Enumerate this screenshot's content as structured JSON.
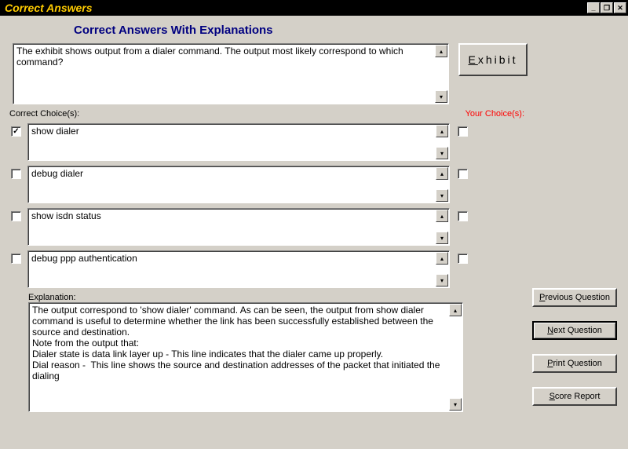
{
  "window": {
    "title": "Correct Answers"
  },
  "heading": "Correct Answers With Explanations",
  "question": "The exhibit shows output from a dialer command. The output most likely correspond to which command?",
  "exhibit_label": "Exhibit",
  "labels": {
    "correct": "Correct Choice(s):",
    "your": "Your Choice(s):"
  },
  "choices": [
    {
      "text": "show dialer",
      "correct_checked": "✓",
      "your_checked": ""
    },
    {
      "text": "debug dialer",
      "correct_checked": "",
      "your_checked": ""
    },
    {
      "text": "show isdn status",
      "correct_checked": "",
      "your_checked": ""
    },
    {
      "text": "debug ppp authentication",
      "correct_checked": "",
      "your_checked": ""
    }
  ],
  "explanation_label": "Explanation:",
  "explanation": "The output correspond to 'show dialer' command. As can be seen, the output from show dialer command is useful to determine whether the link has been successfully established between the source and destination.\nNote from the output that:\nDialer state is data link layer up - This line indicates that the dialer came up properly.\nDial reason -  This line shows the source and destination addresses of the packet that initiated the dialing",
  "buttons": {
    "prev": "Previous Question",
    "next": "Next Question",
    "print": "Print Question",
    "score": "Score Report"
  }
}
